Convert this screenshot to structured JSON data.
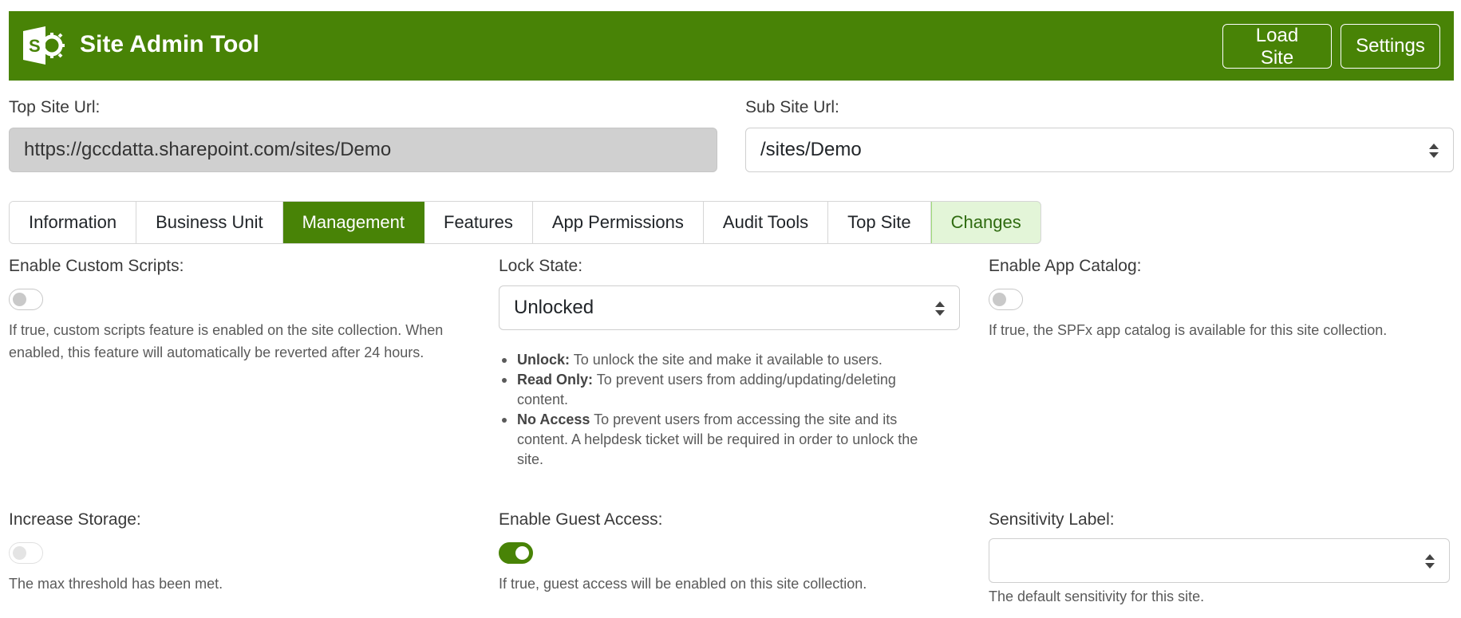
{
  "app": {
    "title": "Site Admin Tool",
    "load_site_label": "Load Site",
    "settings_label": "Settings",
    "accent_color": "#488306"
  },
  "urls": {
    "top_site_label": "Top Site Url:",
    "top_site_value": "https://gccdatta.sharepoint.com/sites/Demo",
    "sub_site_label": "Sub Site Url:",
    "sub_site_value": "/sites/Demo"
  },
  "tabs": [
    {
      "label": "Information"
    },
    {
      "label": "Business Unit"
    },
    {
      "label": "Management",
      "active": true
    },
    {
      "label": "Features"
    },
    {
      "label": "App Permissions"
    },
    {
      "label": "Audit Tools"
    },
    {
      "label": "Top Site"
    },
    {
      "label": "Changes"
    }
  ],
  "management": {
    "custom_scripts": {
      "label": "Enable Custom Scripts:",
      "enabled": false,
      "help_line1": "If true, custom scripts feature is enabled on the site collection. When",
      "help_line2": "enabled, this feature will automatically be reverted after 24 hours."
    },
    "lock_state": {
      "label": "Lock State:",
      "value": "Unlocked",
      "options": [
        {
          "term": "Unlock:",
          "line1": " To unlock the site and make it available to users."
        },
        {
          "term": "Read Only:",
          "line1": " To prevent users from adding/updating/deleting",
          "line2": "content."
        },
        {
          "term": "No Access",
          "line1": " To prevent users from accessing the site and its",
          "line2": "content. A helpdesk ticket will be required in order to unlock the",
          "line3": "site."
        }
      ]
    },
    "app_catalog": {
      "label": "Enable App Catalog:",
      "enabled": false,
      "help": "If true, the SPFx app catalog is available for this site collection."
    },
    "storage": {
      "label": "Increase Storage:",
      "enabled": false,
      "help": "The max threshold has been met."
    },
    "guest_access": {
      "label": "Enable Guest Access:",
      "enabled": true,
      "help": "If true, guest access will be enabled on this site collection."
    },
    "sensitivity": {
      "label": "Sensitivity Label:",
      "value": "",
      "help": "The default sensitivity for this site."
    }
  }
}
